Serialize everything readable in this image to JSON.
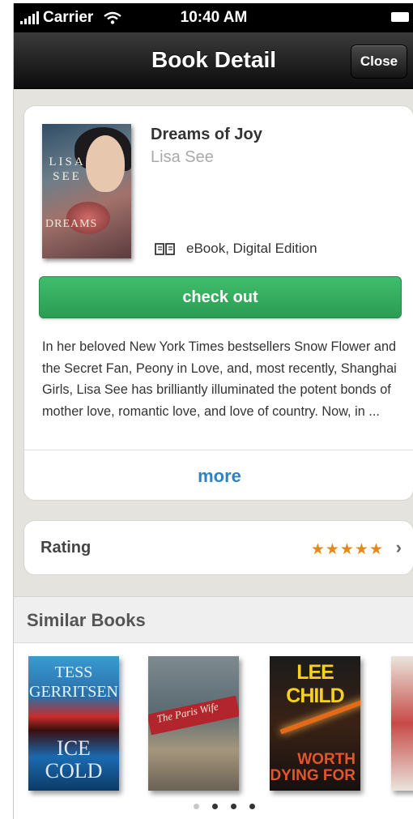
{
  "status_bar": {
    "carrier": "Carrier",
    "time": "10:40 AM"
  },
  "nav": {
    "title": "Book Detail",
    "close_label": "Close"
  },
  "book": {
    "title": "Dreams of Joy",
    "author": "Lisa See",
    "cover_author": "LISA SEE",
    "cover_title": "DREAMS",
    "format": "eBook, Digital Edition",
    "checkout_label": "check out",
    "description": "In her beloved New York Times bestsellers Snow Flower and the Secret Fan, Peony in Love, and, most recently, Shanghai Girls, Lisa See has brilliantly illuminated the potent bonds of mother love, romantic love, and love of country. Now, in ...",
    "more_label": "more"
  },
  "rating": {
    "label": "Rating",
    "stars": 5,
    "stars_text": "★★★★★"
  },
  "similar": {
    "title": "Similar Books",
    "books": [
      {
        "author": "TESS GERRITSEN",
        "title": "ICE COLD"
      },
      {
        "title": "The Paris Wife"
      },
      {
        "author": "LEE CHILD",
        "title": "WORTH DYING FOR"
      },
      {
        "title": ""
      }
    ],
    "pages": 4,
    "current_page": 2
  },
  "colors": {
    "checkout_green": "#2ea85a",
    "link_blue": "#2f83c4",
    "star_orange": "#e4891b"
  }
}
